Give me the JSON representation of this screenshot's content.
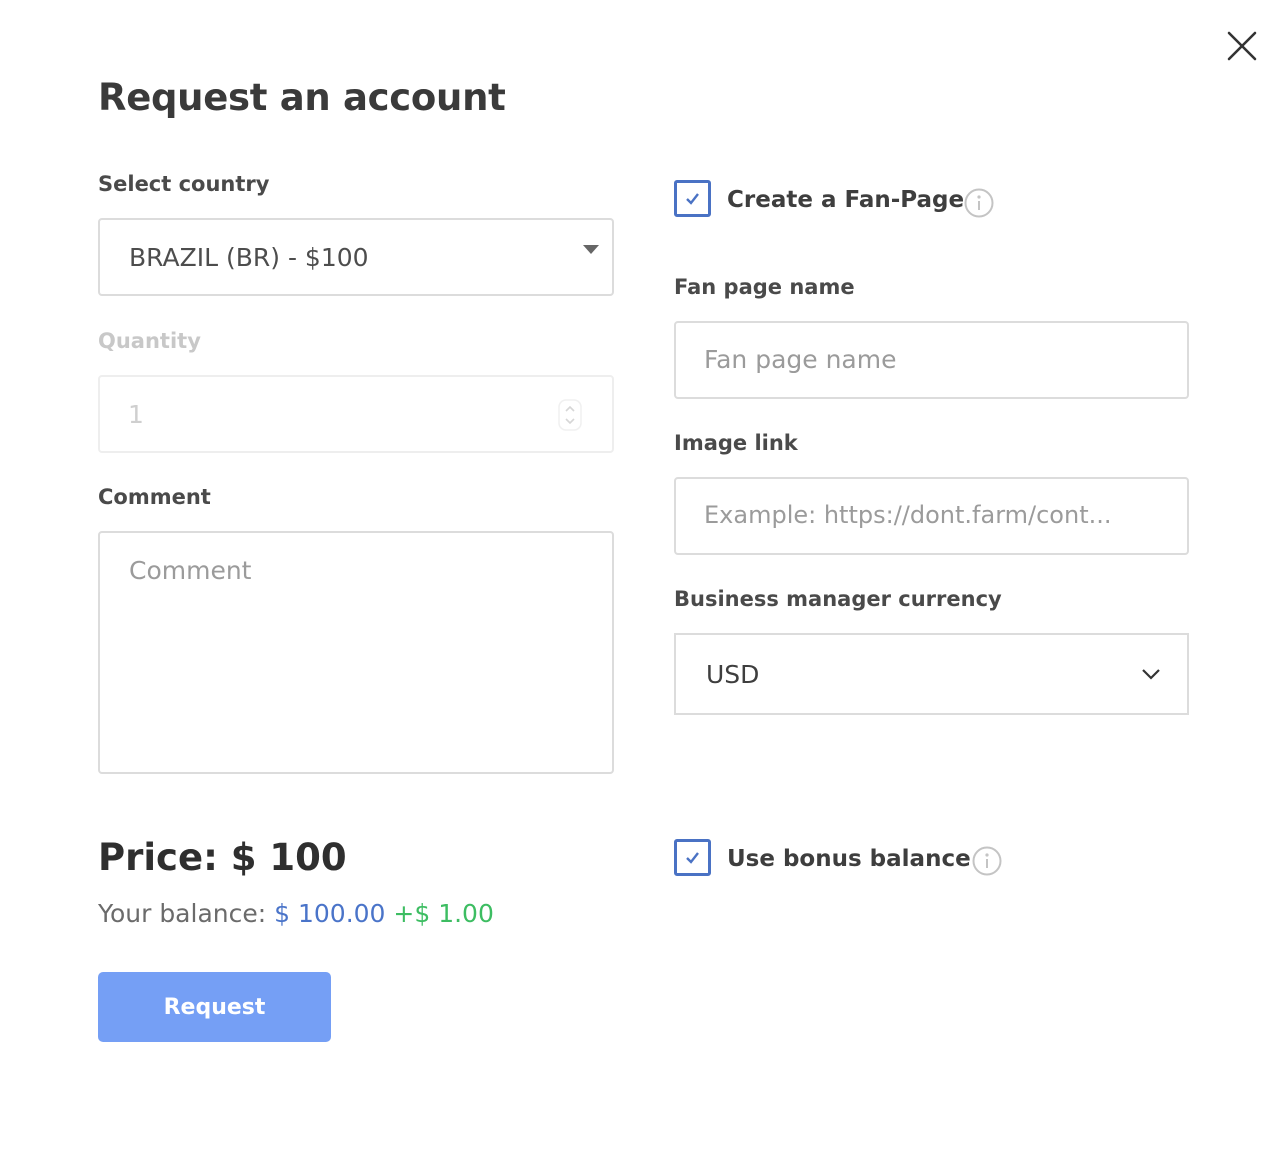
{
  "modal": {
    "title": "Request an account"
  },
  "left": {
    "country_label": "Select country",
    "country_value": "BRAZIL (BR) - $100",
    "quantity_label": "Quantity",
    "quantity_value": "1",
    "comment_label": "Comment",
    "comment_placeholder": "Comment"
  },
  "right": {
    "fanpage_checkbox_label": "Create a Fan-Page",
    "fanpage_checked": true,
    "fanpage_name_label": "Fan page name",
    "fanpage_name_placeholder": "Fan page name",
    "image_link_label": "Image link",
    "image_link_placeholder": "Example: https://dont.farm/cont...",
    "currency_label": "Business manager currency",
    "currency_value": "USD",
    "bonus_checkbox_label": "Use bonus balance",
    "bonus_checked": true
  },
  "footer": {
    "price_text": "Price: $ 100",
    "balance_label": "Your balance:",
    "balance_amount": "$ 100.00",
    "bonus_amount": "+$ 1.00",
    "request_label": "Request"
  },
  "icons": {
    "close": "close-icon",
    "check": "check-icon",
    "info": "info-icon",
    "caret": "caret-down-icon",
    "chevron": "chevron-down-icon",
    "stepper": "stepper-arrows-icon"
  },
  "colors": {
    "accent": "#4a72c4",
    "button": "#759ff5",
    "balance": "#4a74c9",
    "bonus": "#3dbd62"
  }
}
